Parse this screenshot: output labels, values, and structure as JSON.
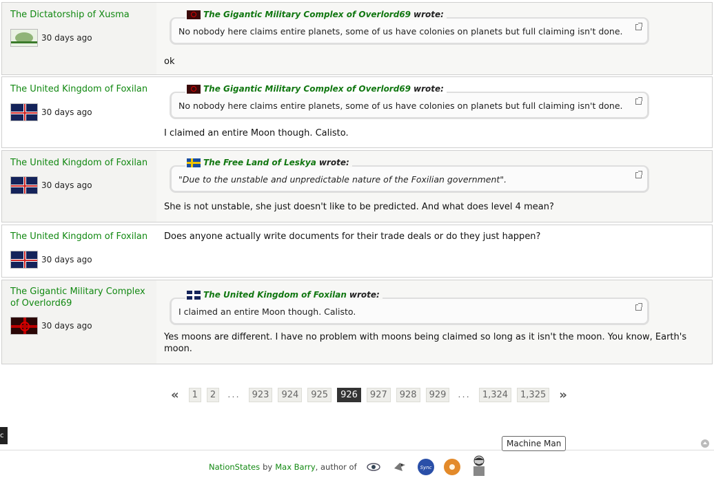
{
  "posts": [
    {
      "author": "The Dictatorship of Xusma",
      "ago": "30 days ago",
      "quote": {
        "name": "The Gigantic Military Complex of Overlord69",
        "wrote": "wrote:",
        "text": "No nobody here claims entire planets, some of us have colonies on planets but full claiming isn't done."
      },
      "message": "ok"
    },
    {
      "author": "The United Kingdom of Foxilan",
      "ago": "30 days ago",
      "quote": {
        "name": "The Gigantic Military Complex of Overlord69",
        "wrote": "wrote:",
        "text": "No nobody here claims entire planets, some of us have colonies on planets but full claiming isn't done."
      },
      "message": "I claimed an entire Moon though. Calisto."
    },
    {
      "author": "The United Kingdom of Foxilan",
      "ago": "30 days ago",
      "quote": {
        "name": "The Free Land of Leskya",
        "wrote": "wrote:",
        "text": "\"Due to the unstable and unpredictable nature of the Foxilian government\"."
      },
      "message": "She is not unstable, she just doesn't like to be predicted. And what does level 4 mean?"
    },
    {
      "author": "The United Kingdom of Foxilan",
      "ago": "30 days ago",
      "message": "Does anyone actually write documents for their trade deals or do they just happen?"
    },
    {
      "author": "The Gigantic Military Complex of Overlord69",
      "ago": "30 days ago",
      "quote": {
        "name": "The United Kingdom of Foxilan",
        "wrote": "wrote:",
        "text": "I claimed an entire Moon though. Calisto."
      },
      "message": "Yes moons are different. I have no problem with moons being claimed so long as it isn't the moon. You know, Earth's moon."
    }
  ],
  "pagination": {
    "first": "«",
    "last": "»",
    "pages": [
      "1",
      "2",
      "...",
      "923",
      "924",
      "925",
      "926",
      "927",
      "928",
      "929",
      "...",
      "1,324",
      "1,325"
    ],
    "current": "926"
  },
  "footer": {
    "site": "NationStates",
    "by": "by",
    "author": "Max Barry",
    "author_of": ", author of",
    "icons": [
      "eye-book-icon",
      "bird-book-icon",
      "sync-book-icon",
      "donut-book-icon",
      "machine-man-icon"
    ]
  },
  "tooltip": "Machine Man",
  "side_tab": "c"
}
